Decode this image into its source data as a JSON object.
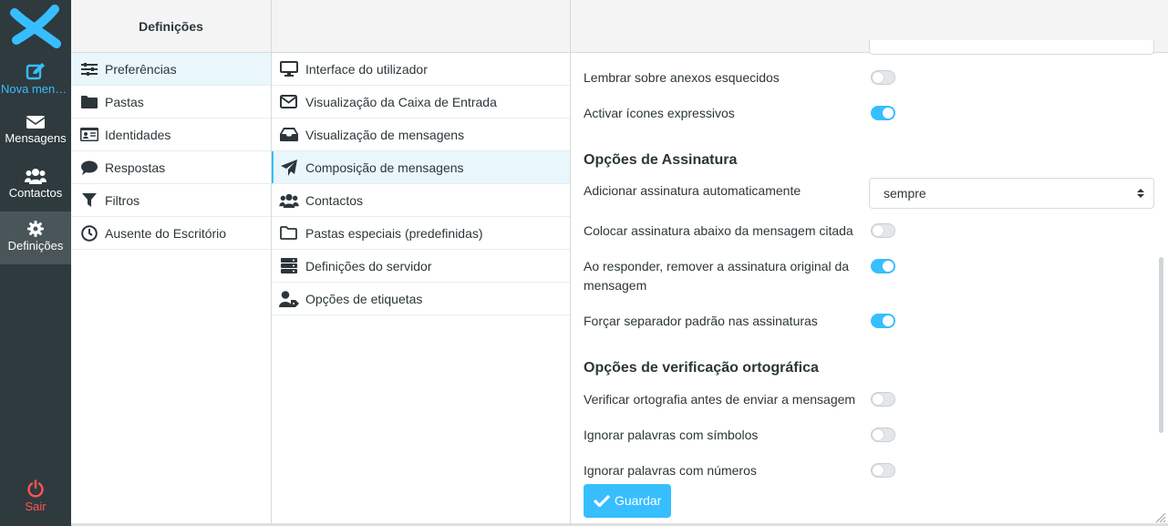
{
  "taskbar": {
    "compose": "Nova mensagem",
    "mail": "Mensagens",
    "contacts": "Contactos",
    "settings": "Definições",
    "logout": "Sair"
  },
  "settings_nav": {
    "title": "Definições",
    "items": [
      {
        "label": "Preferências",
        "icon": "sliders-icon"
      },
      {
        "label": "Pastas",
        "icon": "folder-icon"
      },
      {
        "label": "Identidades",
        "icon": "id-card-icon"
      },
      {
        "label": "Respostas",
        "icon": "comment-icon"
      },
      {
        "label": "Filtros",
        "icon": "filter-icon"
      },
      {
        "label": "Ausente do Escritório",
        "icon": "clock-icon"
      }
    ]
  },
  "sections_nav": {
    "items": [
      {
        "label": "Interface do utilizador",
        "icon": "monitor-icon"
      },
      {
        "label": "Visualização da Caixa de Entrada",
        "icon": "envelope-icon"
      },
      {
        "label": "Visualização de mensagens",
        "icon": "inbox-icon"
      },
      {
        "label": "Composição de mensagens",
        "icon": "paper-plane-icon"
      },
      {
        "label": "Contactos",
        "icon": "users-icon"
      },
      {
        "label": "Pastas especiais (predefinidas)",
        "icon": "folder-outline-icon"
      },
      {
        "label": "Definições do servidor",
        "icon": "server-icon"
      },
      {
        "label": "Opções de etiquetas",
        "icon": "user-tag-icon"
      }
    ]
  },
  "prefs": {
    "remind_attach": {
      "label": "Lembrar sobre anexos esquecidos",
      "on": false
    },
    "emoticons": {
      "label": "Activar ícones expressivos",
      "on": true
    },
    "signature_title": "Opções de Assinatura",
    "auto_sig": {
      "label": "Adicionar assinatura automaticamente",
      "value": "sempre"
    },
    "sig_below": {
      "label": "Colocar assinatura abaixo da mensagem citada",
      "on": false
    },
    "strip_sig": {
      "label": "Ao responder, remover a assinatura original da mensagem",
      "on": true
    },
    "sig_sep": {
      "label": "Forçar separador padrão nas assinaturas",
      "on": true
    },
    "spell_title": "Opções de verificação ortográfica",
    "spell_before": {
      "label": "Verificar ortografia antes de enviar a mensagem",
      "on": false
    },
    "ignore_symbols": {
      "label": "Ignorar palavras com símbolos",
      "on": false
    },
    "ignore_numbers": {
      "label": "Ignorar palavras com números",
      "on": false
    },
    "save": "Guardar"
  },
  "colors": {
    "accent": "#37beff",
    "taskbar": "#2f3a3f",
    "logout": "#ff5552"
  }
}
